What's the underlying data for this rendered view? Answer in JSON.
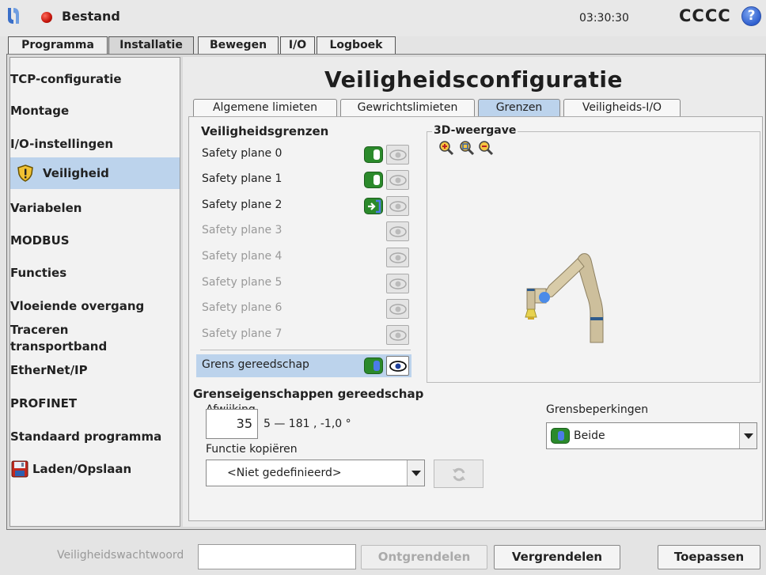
{
  "header": {
    "file_name": "Bestand",
    "clock": "03:30:30",
    "robot_name": "CCCC",
    "help_glyph": "?"
  },
  "main_tabs": [
    {
      "label": "Programma",
      "active": false
    },
    {
      "label": "Installatie",
      "active": true
    },
    {
      "label": "Bewegen",
      "active": false
    },
    {
      "label": "I/O",
      "active": false
    },
    {
      "label": "Logboek",
      "active": false
    }
  ],
  "sidebar": {
    "items": [
      {
        "label": "TCP-configuratie"
      },
      {
        "label": "Montage"
      },
      {
        "label": "I/O-instellingen"
      },
      {
        "label": "Veiligheid",
        "active": true,
        "icon": "shield-warning-icon"
      },
      {
        "label": "Variabelen"
      },
      {
        "label": "MODBUS"
      },
      {
        "label": "Functies"
      },
      {
        "label": "Vloeiende overgang"
      },
      {
        "label": "Traceren",
        "label2": "transportband"
      },
      {
        "label": "EtherNet/IP"
      },
      {
        "label": "PROFINET"
      },
      {
        "label": "Standaard programma"
      },
      {
        "label": "Laden/Opslaan",
        "icon": "floppy-disk-icon"
      }
    ]
  },
  "content": {
    "title": "Veiligheidsconfiguratie",
    "sub_tabs": [
      {
        "label": "Algemene limieten",
        "active": false
      },
      {
        "label": "Gewrichtslimieten",
        "active": false
      },
      {
        "label": "Grenzen",
        "active": true
      },
      {
        "label": "Veiligheids-I/O",
        "active": false
      }
    ],
    "boundaries_heading": "Veiligheidsgrenzen",
    "planes": [
      {
        "label": "Safety plane 0",
        "enabled": true,
        "mode": "normal"
      },
      {
        "label": "Safety plane 1",
        "enabled": true,
        "mode": "normal"
      },
      {
        "label": "Safety plane 2",
        "enabled": true,
        "mode": "trigger"
      },
      {
        "label": "Safety plane 3",
        "enabled": false
      },
      {
        "label": "Safety plane 4",
        "enabled": false
      },
      {
        "label": "Safety plane 5",
        "enabled": false
      },
      {
        "label": "Safety plane 6",
        "enabled": false
      },
      {
        "label": "Safety plane 7",
        "enabled": false
      }
    ],
    "tool_boundary": {
      "label": "Grens gereedschap",
      "enabled": true,
      "visible": true
    },
    "view_label": "3D-weergave",
    "tool_props_heading": "Grenseigenschappen gereedschap",
    "offset_label": "Afwijking",
    "offset_value": "35",
    "offset_range": "5 — 181 , -1,0 °",
    "restrictions_label": "Grensbeperkingen",
    "restrictions_value": "Beide",
    "copy_label": "Functie kopiëren",
    "copy_value": "<Niet gedefinieerd>"
  },
  "footer": {
    "password_label": "Veiligheidswachtwoord",
    "password_value": "",
    "unlock_label": "Ontgrendelen",
    "lock_label": "Vergrendelen",
    "apply_label": "Toepassen"
  },
  "colors": {
    "accent_selection": "#bcd3ec",
    "toggle_green": "#2b8a2b",
    "status_red": "#c4140a",
    "help_blue": "#2f5fcf"
  }
}
